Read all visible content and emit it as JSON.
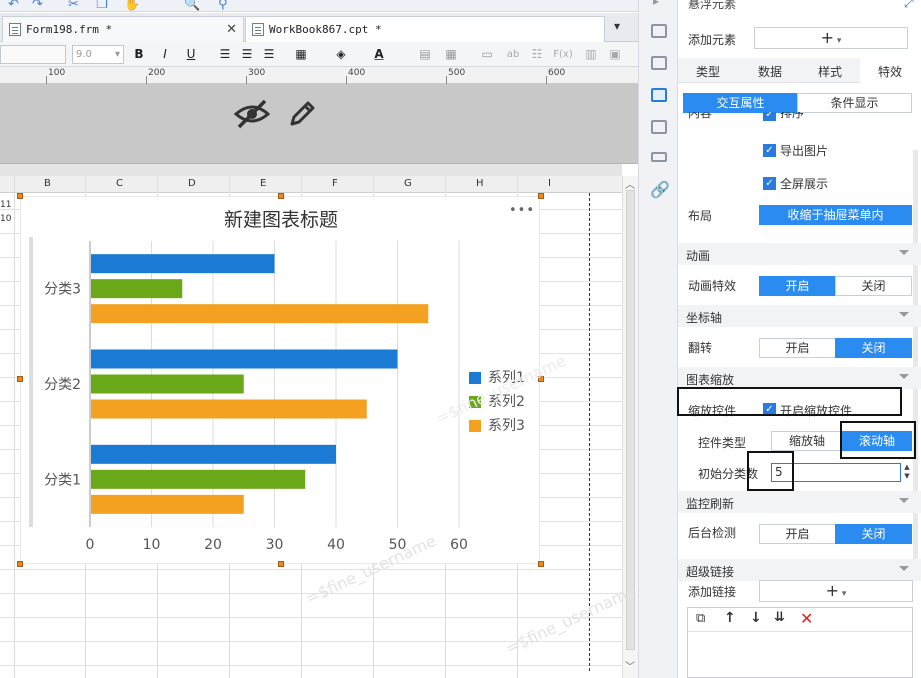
{
  "file_tabs": [
    {
      "label": "Form198.frm *"
    },
    {
      "label": "WorkBook867.cpt *"
    }
  ],
  "format_toolbar": {
    "font_size": "9.0",
    "bold": "B",
    "italic": "I",
    "underline": "U",
    "font_color": "A",
    "text_ab": "ab",
    "fx": "F(x)"
  },
  "ruler_marks": [
    "100",
    "200",
    "300",
    "400",
    "500",
    "600"
  ],
  "column_headers": [
    "B",
    "C",
    "D",
    "E",
    "F",
    "G",
    "H",
    "I"
  ],
  "row_fragments": [
    "11",
    "10"
  ],
  "chart_data": {
    "type": "bar",
    "orientation": "horizontal",
    "title": "新建图表标题",
    "categories": [
      "分类1",
      "分类2",
      "分类3"
    ],
    "series": [
      {
        "name": "系列1",
        "color": "#1a7ad4",
        "values": [
          40,
          50,
          30
        ]
      },
      {
        "name": "系列2",
        "color": "#6aa81a",
        "values": [
          35,
          25,
          15
        ]
      },
      {
        "name": "系列3",
        "color": "#f4a020",
        "values": [
          25,
          45,
          55
        ]
      }
    ],
    "xlim": [
      0,
      60
    ],
    "x_ticks": [
      "0",
      "10",
      "20",
      "30",
      "40",
      "50",
      "60"
    ],
    "grid": true,
    "legend": "right",
    "menu_glyph": "•••"
  },
  "panel": {
    "header": "悬浮元素",
    "add_element_label": "添加元素",
    "add_element_btn": "+",
    "tabs": [
      "类型",
      "数据",
      "样式",
      "特效"
    ],
    "subtabs": [
      "交互属性",
      "条件显示"
    ],
    "clipped_label": "内容",
    "checks": {
      "sort": "排序",
      "export_image": "导出图片",
      "fullscreen": "全屏展示"
    },
    "layout_label": "布局",
    "layout_value": "收缩于抽屉菜单内",
    "sections": {
      "animation": "动画",
      "axis": "坐标轴",
      "zoom": "图表缩放",
      "monitor": "监控刷新",
      "hyperlink": "超级链接"
    },
    "anim_effect_label": "动画特效",
    "flip_label": "翻转",
    "open": "开启",
    "close": "关闭",
    "zoom_control_label": "缩放控件",
    "zoom_control_check": "开启缩放控件",
    "control_type_label": "控件类型",
    "zoom_axis": "缩放轴",
    "scroll_axis": "滚动轴",
    "init_category_label": "初始分类数",
    "init_category_value": "5",
    "bg_check_label": "后台检测",
    "add_link_label": "添加链接",
    "add_link_btn": "+"
  },
  "watermark": "=$fine_username"
}
